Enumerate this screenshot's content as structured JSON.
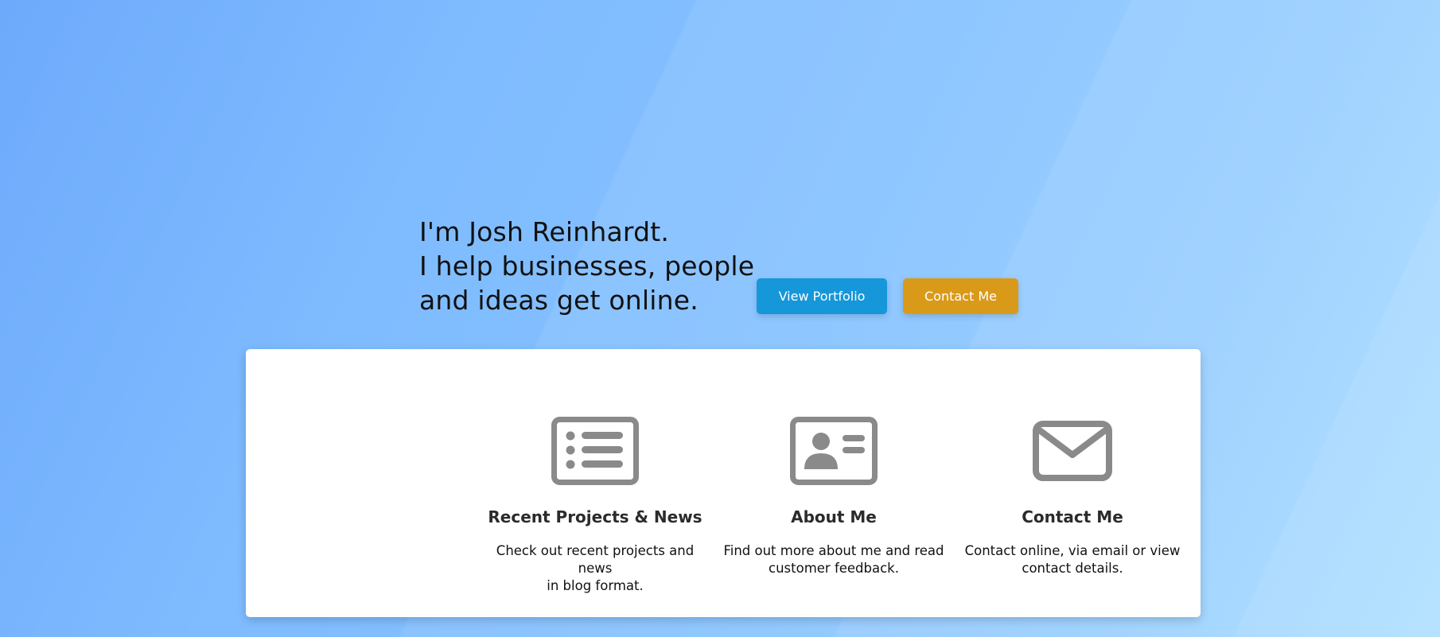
{
  "hero": {
    "line1": "I'm Josh Reinhardt.",
    "line2": "I help businesses, people",
    "line3": "and ideas get online."
  },
  "buttons": {
    "portfolio_label": "View Portfolio",
    "contact_label": "Contact Me"
  },
  "features": [
    {
      "icon": "news-list-icon",
      "title": "Recent Projects & News",
      "description_line1": "Check out recent projects and news",
      "description_line2": "in blog format."
    },
    {
      "icon": "id-card-icon",
      "title": "About Me",
      "description_line1": "Find out more about me and read",
      "description_line2": "customer feedback."
    },
    {
      "icon": "envelope-icon",
      "title": "Contact Me",
      "description_line1": "Contact online, via email or view",
      "description_line2": "contact details."
    }
  ],
  "colors": {
    "portfolio_button": "#1597d9",
    "contact_button": "#d99a1a",
    "icon": "#8a8a8a"
  }
}
